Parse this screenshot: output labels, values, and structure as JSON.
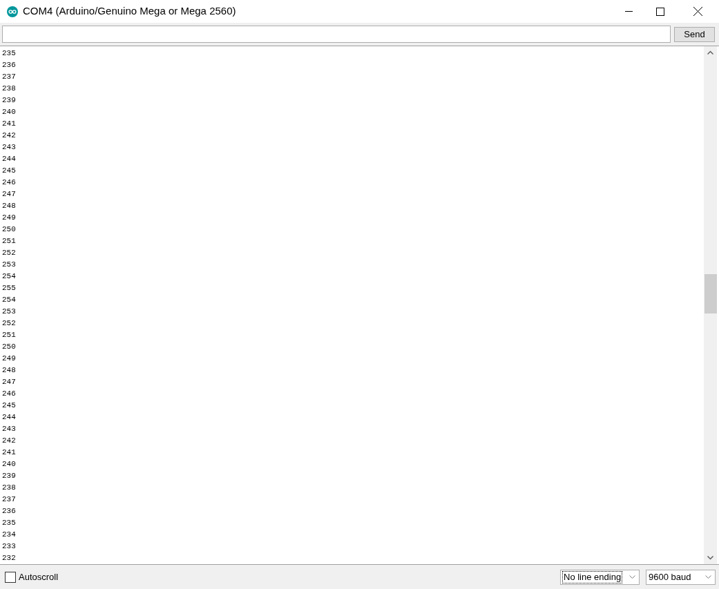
{
  "window": {
    "title": "COM4 (Arduino/Genuino Mega or Mega 2560)"
  },
  "send_button": "Send",
  "output_lines": [
    "235",
    "236",
    "237",
    "238",
    "239",
    "240",
    "241",
    "242",
    "243",
    "244",
    "245",
    "246",
    "247",
    "248",
    "249",
    "250",
    "251",
    "252",
    "253",
    "254",
    "255",
    "254",
    "253",
    "252",
    "251",
    "250",
    "249",
    "248",
    "247",
    "246",
    "245",
    "244",
    "243",
    "242",
    "241",
    "240",
    "239",
    "238",
    "237",
    "236",
    "235",
    "234",
    "233",
    "232"
  ],
  "autoscroll": {
    "label": "Autoscroll",
    "checked": false
  },
  "line_ending": {
    "value": "No line ending"
  },
  "baud_rate": {
    "value": "9600 baud"
  }
}
